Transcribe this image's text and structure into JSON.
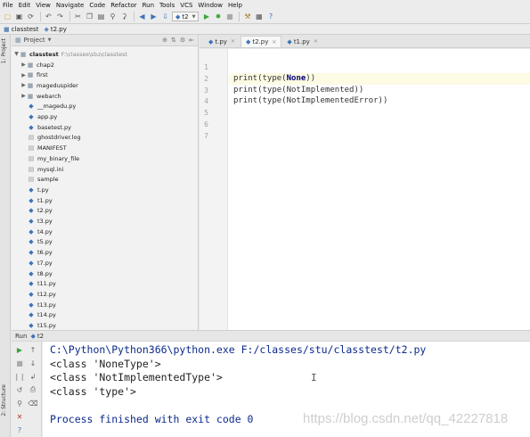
{
  "menu": [
    "File",
    "Edit",
    "View",
    "Navigate",
    "Code",
    "Refactor",
    "Run",
    "Tools",
    "VCS",
    "Window",
    "Help"
  ],
  "toolbar": {
    "run_config": "t2"
  },
  "breadcrumb": {
    "folder": "classtest",
    "file": "t2.py"
  },
  "side_strips": {
    "project": "1: Project",
    "structure": "2: Structure"
  },
  "project_panel": {
    "title": "Project",
    "root_name": "classtest",
    "root_path": "F:\\classes\\stu\\classtest",
    "items": [
      {
        "label": "chap2",
        "kind": "folder"
      },
      {
        "label": "first",
        "kind": "folder"
      },
      {
        "label": "mageduspider",
        "kind": "folder"
      },
      {
        "label": "webarch",
        "kind": "folder"
      },
      {
        "label": "__magedu.py",
        "kind": "py"
      },
      {
        "label": "app.py",
        "kind": "py"
      },
      {
        "label": "basetest.py",
        "kind": "py"
      },
      {
        "label": "ghostdriver.log",
        "kind": "txt"
      },
      {
        "label": "MANIFEST",
        "kind": "txt"
      },
      {
        "label": "my_binary_file",
        "kind": "txt"
      },
      {
        "label": "mysql.ini",
        "kind": "txt"
      },
      {
        "label": "sample",
        "kind": "txt"
      },
      {
        "label": "t.py",
        "kind": "py"
      },
      {
        "label": "t1.py",
        "kind": "py"
      },
      {
        "label": "t2.py",
        "kind": "py"
      },
      {
        "label": "t3.py",
        "kind": "py"
      },
      {
        "label": "t4.py",
        "kind": "py"
      },
      {
        "label": "t5.py",
        "kind": "py"
      },
      {
        "label": "t6.py",
        "kind": "py"
      },
      {
        "label": "t7.py",
        "kind": "py"
      },
      {
        "label": "t8.py",
        "kind": "py"
      },
      {
        "label": "t11.py",
        "kind": "py"
      },
      {
        "label": "t12.py",
        "kind": "py"
      },
      {
        "label": "t13.py",
        "kind": "py"
      },
      {
        "label": "t14.py",
        "kind": "py"
      },
      {
        "label": "t15.py",
        "kind": "py"
      }
    ]
  },
  "editor": {
    "tabs": [
      {
        "label": "t.py",
        "active": false
      },
      {
        "label": "t2.py",
        "active": true
      },
      {
        "label": "t1.py",
        "active": false
      }
    ],
    "lines": [
      {
        "no": "1",
        "pre": "",
        "kw": "",
        "post": ""
      },
      {
        "no": "2",
        "pre": "print(type(",
        "kw": "None",
        "post": "))"
      },
      {
        "no": "3",
        "pre": "print(type(NotImplemented))",
        "kw": "",
        "post": ""
      },
      {
        "no": "4",
        "pre": "print(type(NotImplementedError))",
        "kw": "",
        "post": ""
      },
      {
        "no": "5",
        "pre": "",
        "kw": "",
        "post": ""
      },
      {
        "no": "6",
        "pre": "",
        "kw": "",
        "post": ""
      },
      {
        "no": "7",
        "pre": "",
        "kw": "",
        "post": ""
      }
    ]
  },
  "run_panel": {
    "label": "Run",
    "config": "t2",
    "console": [
      {
        "text": "C:\\Python\\Python366\\python.exe F:/classes/stu/classtest/t2.py",
        "kind": "cmd"
      },
      {
        "text": "<class 'NoneType'>",
        "kind": "out"
      },
      {
        "text": "<class 'NotImplementedType'>",
        "kind": "out"
      },
      {
        "text": "<class 'type'>",
        "kind": "out"
      },
      {
        "text": "",
        "kind": "out"
      },
      {
        "text": "Process finished with exit code 0",
        "kind": "done"
      }
    ],
    "watermark": "https://blog.csdn.net/qq_42227818"
  }
}
